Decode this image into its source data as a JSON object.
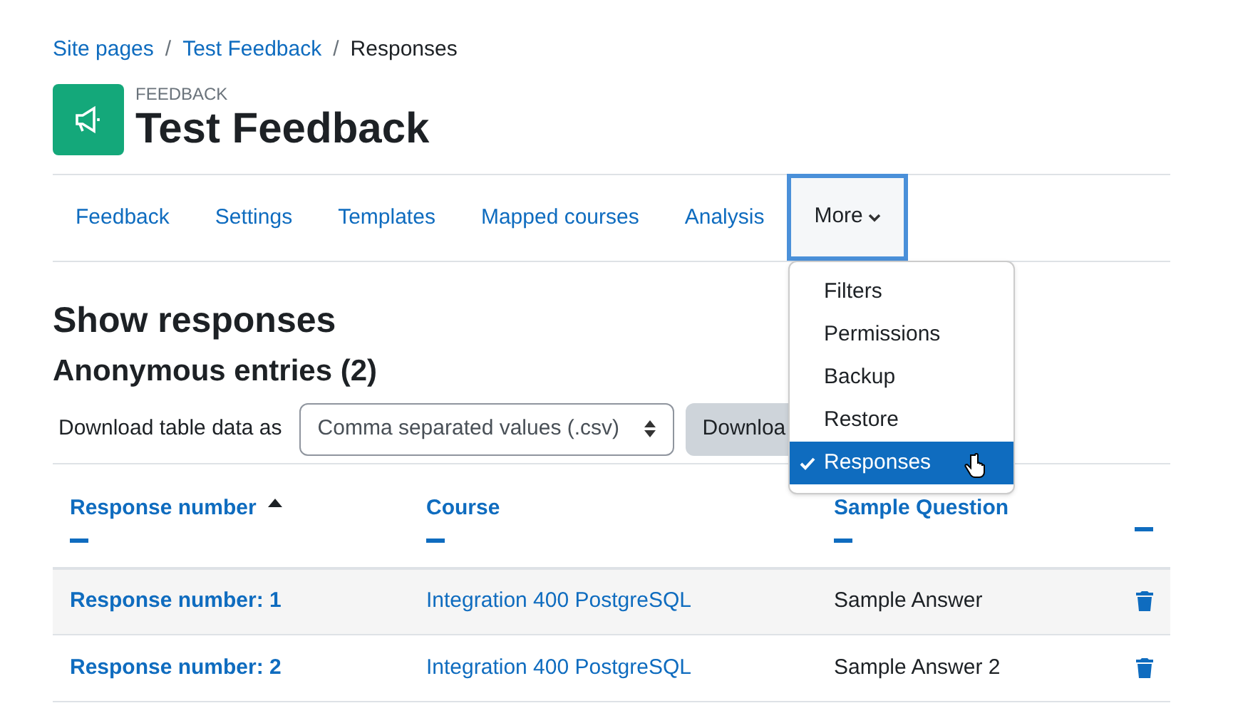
{
  "breadcrumb": [
    {
      "label": "Site pages",
      "link": true
    },
    {
      "separator": "/",
      "label": "Test Feedback",
      "link": true
    },
    {
      "separator": "/",
      "label": "Responses",
      "link": false
    }
  ],
  "header": {
    "kicker": "FEEDBACK",
    "title": "Test Feedback"
  },
  "tabs": [
    {
      "label": "Feedback",
      "selected": false
    },
    {
      "label": "Settings",
      "selected": false
    },
    {
      "label": "Templates",
      "selected": false
    },
    {
      "label": "Mapped courses",
      "selected": false
    },
    {
      "label": "Analysis",
      "selected": false
    },
    {
      "label": "More",
      "selected": true,
      "kind": "menu"
    }
  ],
  "more_menu": [
    {
      "label": "Filters",
      "selected": false
    },
    {
      "label": "Permissions",
      "selected": false
    },
    {
      "label": "Backup",
      "selected": false
    },
    {
      "label": "Restore",
      "selected": false
    },
    {
      "label": "Responses",
      "selected": true
    }
  ],
  "heading": "Show responses",
  "subheading": "Anonymous entries (2)",
  "download": {
    "label": "Download table data as",
    "format": "Comma separated values (.csv)",
    "button": "Downloa"
  },
  "table": {
    "columns": [
      {
        "label": "Response number",
        "sorted": true
      },
      {
        "label": "Course",
        "sorted": false
      },
      {
        "label": "Sample Question",
        "sorted": false
      },
      {
        "sorted": false
      }
    ],
    "rows": [
      {
        "response": "Response number: 1",
        "course": "Integration 400 PostgreSQL",
        "answer": "Sample Answer"
      },
      {
        "response": "Response number: 2",
        "course": "Integration 400 PostgreSQL",
        "answer": "Sample Answer 2"
      }
    ]
  }
}
